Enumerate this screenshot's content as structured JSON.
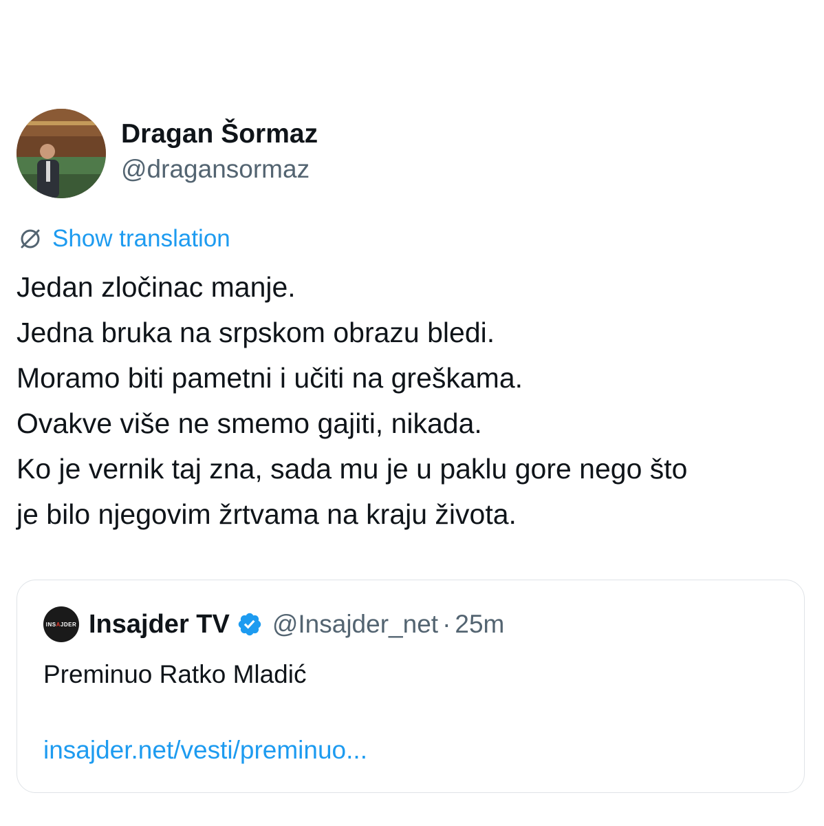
{
  "author": {
    "display_name": "Dragan Šormaz",
    "handle": "@dragansormaz",
    "avatar_icon": "profile-photo"
  },
  "translation": {
    "label": "Show translation",
    "icon": "translate-icon"
  },
  "tweet": {
    "lines": [
      "Jedan zločinac manje.",
      "Jedna bruka na srpskom obrazu bledi.",
      "Moramo biti pametni i učiti na greškama.",
      "Ovakve više ne smemo gajiti, nikada.",
      "Ko je vernik taj zna, sada mu je u paklu gore nego što",
      "je bilo njegovim žrtvama na kraju života."
    ]
  },
  "quoted_tweet": {
    "avatar_text_left": "INS",
    "avatar_text_mid": "A",
    "avatar_text_right": "JDER",
    "name": "Insajder TV",
    "verified_icon": "verified-badge-icon",
    "handle": "@Insajder_net",
    "separator": "·",
    "time": "25m",
    "text": "Preminuo Ratko Mladić",
    "link": "insajder.net/vesti/preminuo..."
  },
  "colors": {
    "link": "#1d9bf0",
    "secondary_text": "#536471",
    "primary_text": "#0f1419",
    "border": "#dfe3e7"
  }
}
